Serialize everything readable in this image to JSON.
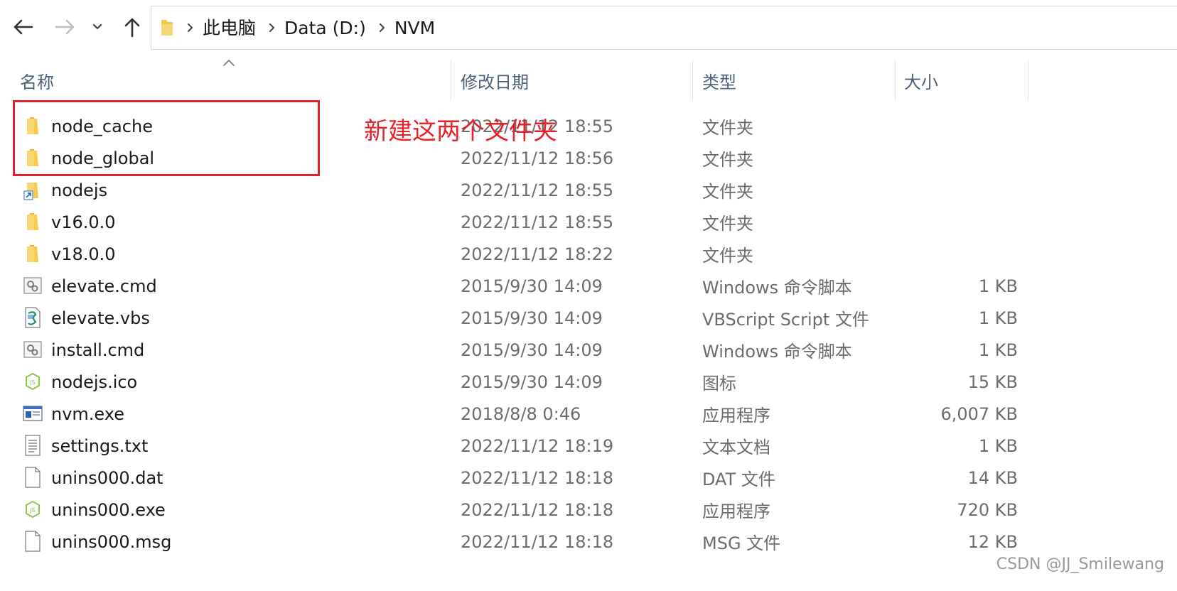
{
  "nav": {
    "back_icon": "arrow-left-icon",
    "forward_icon": "arrow-right-icon",
    "recent_icon": "chevron-down-icon",
    "up_icon": "arrow-up-icon"
  },
  "breadcrumb": {
    "items": [
      "此电脑",
      "Data (D:)",
      "NVM"
    ]
  },
  "columns": {
    "name": "名称",
    "date": "修改日期",
    "type": "类型",
    "size": "大小"
  },
  "files": [
    {
      "name": "node_cache",
      "date": "2022/11/12 18:55",
      "type": "文件夹",
      "size": "",
      "icon": "folder-icon"
    },
    {
      "name": "node_global",
      "date": "2022/11/12 18:56",
      "type": "文件夹",
      "size": "",
      "icon": "folder-icon"
    },
    {
      "name": "nodejs",
      "date": "2022/11/12 18:55",
      "type": "文件夹",
      "size": "",
      "icon": "folder-shortcut-icon"
    },
    {
      "name": "v16.0.0",
      "date": "2022/11/12 18:55",
      "type": "文件夹",
      "size": "",
      "icon": "folder-icon"
    },
    {
      "name": "v18.0.0",
      "date": "2022/11/12 18:22",
      "type": "文件夹",
      "size": "",
      "icon": "folder-icon"
    },
    {
      "name": "elevate.cmd",
      "date": "2015/9/30 14:09",
      "type": "Windows 命令脚本",
      "size": "1 KB",
      "icon": "cmd-file-icon"
    },
    {
      "name": "elevate.vbs",
      "date": "2015/9/30 14:09",
      "type": "VBScript Script 文件",
      "size": "1 KB",
      "icon": "vbs-file-icon"
    },
    {
      "name": "install.cmd",
      "date": "2015/9/30 14:09",
      "type": "Windows 命令脚本",
      "size": "1 KB",
      "icon": "cmd-file-icon"
    },
    {
      "name": "nodejs.ico",
      "date": "2015/9/30 14:09",
      "type": "图标",
      "size": "15 KB",
      "icon": "nodejs-icon"
    },
    {
      "name": "nvm.exe",
      "date": "2018/8/8 0:46",
      "type": "应用程序",
      "size": "6,007 KB",
      "icon": "exe-app-icon"
    },
    {
      "name": "settings.txt",
      "date": "2022/11/12 18:19",
      "type": "文本文档",
      "size": "1 KB",
      "icon": "text-file-icon"
    },
    {
      "name": "unins000.dat",
      "date": "2022/11/12 18:18",
      "type": "DAT 文件",
      "size": "14 KB",
      "icon": "blank-file-icon"
    },
    {
      "name": "unins000.exe",
      "date": "2022/11/12 18:18",
      "type": "应用程序",
      "size": "720 KB",
      "icon": "nodejs-icon"
    },
    {
      "name": "unins000.msg",
      "date": "2022/11/12 18:18",
      "type": "MSG 文件",
      "size": "12 KB",
      "icon": "blank-file-icon"
    }
  ],
  "annotation": {
    "text": "新建这两个文件夹",
    "color": "#e8202a"
  },
  "watermark": "CSDN @JJ_Smilewang",
  "colors": {
    "header_text": "#4c607a",
    "folder": "#f2c94c",
    "highlight": "#e0202a"
  }
}
